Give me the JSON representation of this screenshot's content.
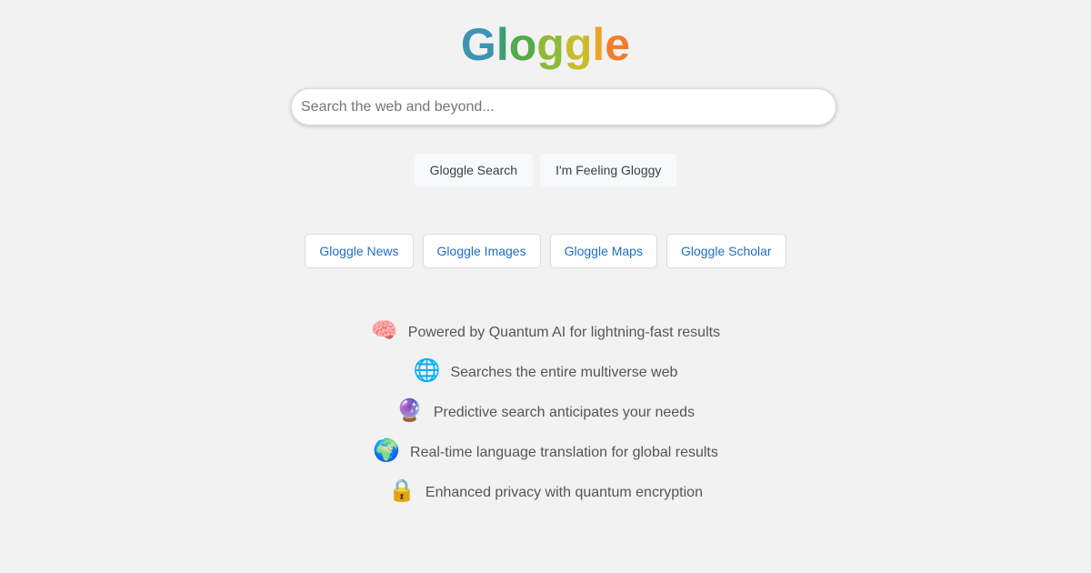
{
  "logo": {
    "letters": [
      "G",
      "l",
      "o",
      "g",
      "g",
      "l",
      "e"
    ],
    "colors": [
      "#3d94b2",
      "#3c9e76",
      "#52ab4a",
      "#8fb93a",
      "#c9bc2c",
      "#eda32a",
      "#f17d2d"
    ]
  },
  "search": {
    "placeholder": "Search the web and beyond...",
    "value": ""
  },
  "buttons": {
    "search_label": "Gloggle Search",
    "lucky_label": "I'm Feeling Gloggy"
  },
  "services": [
    {
      "label": "Gloggle News"
    },
    {
      "label": "Gloggle Images"
    },
    {
      "label": "Gloggle Maps"
    },
    {
      "label": "Gloggle Scholar"
    }
  ],
  "features": [
    {
      "icon": "🧠",
      "icon_name": "brain-icon",
      "text": "Powered by Quantum AI for lightning-fast results"
    },
    {
      "icon": "🌐",
      "icon_name": "globe-meridians-icon",
      "text": "Searches the entire multiverse web"
    },
    {
      "icon": "🔮",
      "icon_name": "crystal-ball-icon",
      "text": "Predictive search anticipates your needs"
    },
    {
      "icon": "🌍",
      "icon_name": "earth-globe-icon",
      "text": "Real-time language translation for global results"
    },
    {
      "icon": "🔒",
      "icon_name": "lock-icon",
      "text": "Enhanced privacy with quantum encryption"
    }
  ],
  "theme": {
    "background": "#f2f2f2",
    "link_color": "#1f6fc0",
    "text_color": "#555555"
  }
}
